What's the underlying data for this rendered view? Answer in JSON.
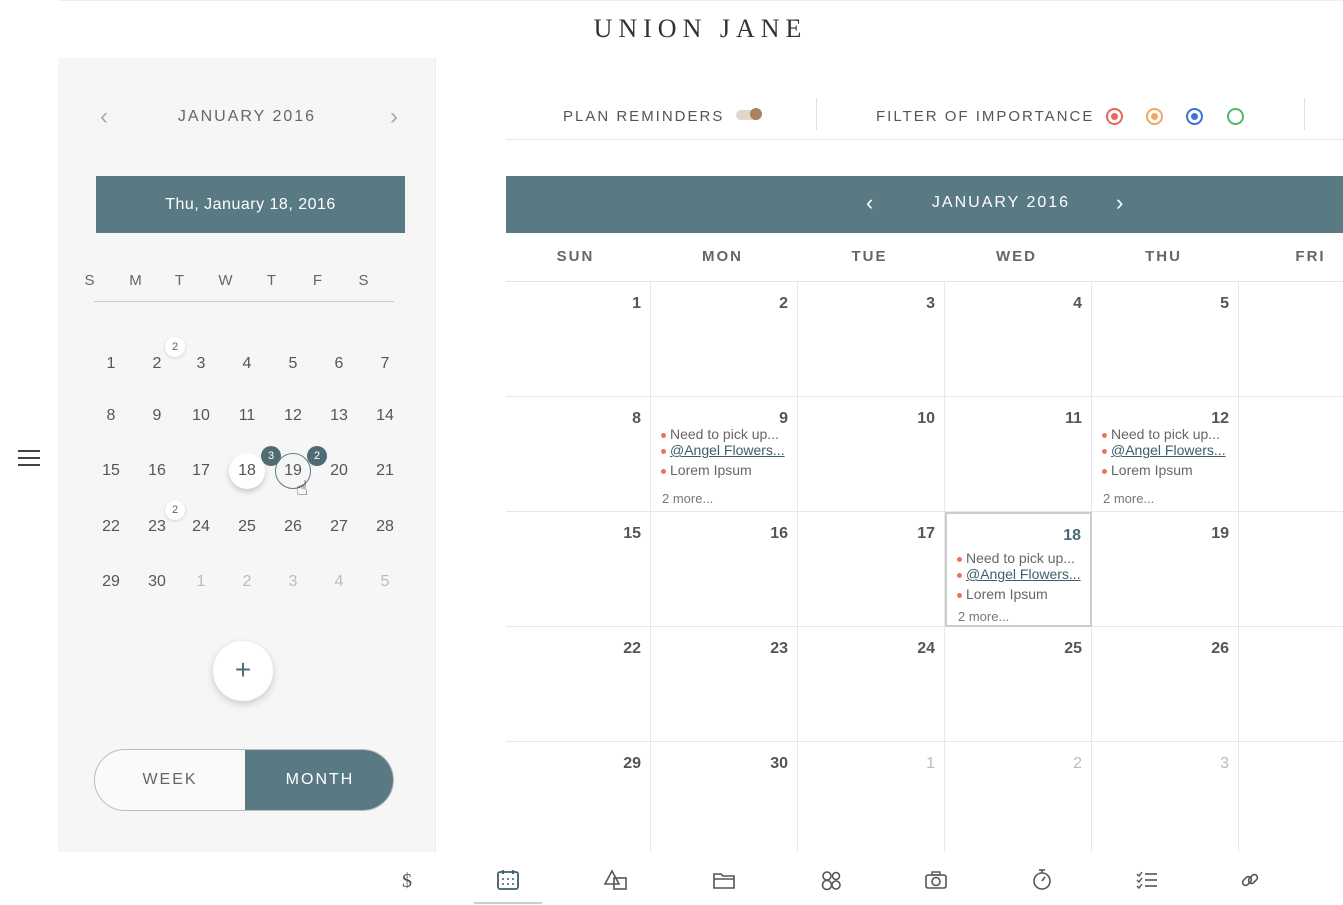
{
  "brand": "UNION JANE",
  "left": {
    "month_label": "JANUARY 2016",
    "selected_date_label": "Thu, January 18, 2016",
    "weekday_headers": [
      "S",
      "M",
      "T",
      "W",
      "T",
      "F",
      "S"
    ],
    "days": [
      {
        "label": "1"
      },
      {
        "label": "2",
        "badge": "2"
      },
      {
        "label": "3"
      },
      {
        "label": "4"
      },
      {
        "label": "5"
      },
      {
        "label": "6"
      },
      {
        "label": "7"
      },
      {
        "label": "8"
      },
      {
        "label": "9"
      },
      {
        "label": "10"
      },
      {
        "label": "11"
      },
      {
        "label": "12"
      },
      {
        "label": "13"
      },
      {
        "label": "14"
      },
      {
        "label": "15"
      },
      {
        "label": "16"
      },
      {
        "label": "17"
      },
      {
        "label": "18",
        "badge": "3",
        "state": "today"
      },
      {
        "label": "19",
        "badge": "2",
        "state": "hover"
      },
      {
        "label": "20"
      },
      {
        "label": "21"
      },
      {
        "label": "22"
      },
      {
        "label": "23",
        "badge": "2"
      },
      {
        "label": "24"
      },
      {
        "label": "25"
      },
      {
        "label": "26"
      },
      {
        "label": "27"
      },
      {
        "label": "28"
      },
      {
        "label": "29"
      },
      {
        "label": "30"
      },
      {
        "label": "1",
        "dim": true
      },
      {
        "label": "2",
        "dim": true
      },
      {
        "label": "3",
        "dim": true
      },
      {
        "label": "4",
        "dim": true
      },
      {
        "label": "5",
        "dim": true
      }
    ],
    "add_label": "+",
    "view_toggle": {
      "week": "WEEK",
      "month": "MONTH",
      "active": "month"
    }
  },
  "filters": {
    "plan_reminders_label": "PLAN REMINDERS",
    "plan_reminders_on": true,
    "importance_label": "FILTER OF IMPORTANCE",
    "importance_colors": [
      "#e8665a",
      "#f0a860",
      "#3f6fd8",
      "#4fb86a"
    ]
  },
  "calendar": {
    "title": "JANUARY 2016",
    "weekdays": [
      "SUN",
      "MON",
      "TUE",
      "WED",
      "THU",
      "FRI"
    ],
    "weeks": [
      [
        {
          "day": "1"
        },
        {
          "day": "2"
        },
        {
          "day": "3"
        },
        {
          "day": "4"
        },
        {
          "day": "5"
        },
        {
          "day": ""
        }
      ],
      [
        {
          "day": "8"
        },
        {
          "day": "9",
          "events": true
        },
        {
          "day": "10"
        },
        {
          "day": "11"
        },
        {
          "day": "12",
          "events": true
        },
        {
          "day": ""
        }
      ],
      [
        {
          "day": "15"
        },
        {
          "day": "16"
        },
        {
          "day": "17"
        },
        {
          "day": "18",
          "events": true,
          "selected": true
        },
        {
          "day": "19"
        },
        {
          "day": ""
        }
      ],
      [
        {
          "day": "22"
        },
        {
          "day": "23"
        },
        {
          "day": "24"
        },
        {
          "day": "25"
        },
        {
          "day": "26"
        },
        {
          "day": ""
        }
      ],
      [
        {
          "day": "29"
        },
        {
          "day": "30"
        },
        {
          "day": "1",
          "dim": true
        },
        {
          "day": "2",
          "dim": true
        },
        {
          "day": "3",
          "dim": true
        },
        {
          "day": ""
        }
      ]
    ],
    "event_lines": [
      "Need to pick up...",
      "@Angel Flowers...",
      "Lorem Ipsum"
    ],
    "more_label": "2 more..."
  },
  "toolbar": {
    "icons": [
      "dollar-icon",
      "calendar-icon",
      "shapes-icon",
      "folder-icon",
      "contacts-icon",
      "camera-icon",
      "stopwatch-icon",
      "checklist-icon",
      "link-icon"
    ],
    "active": "calendar-icon"
  }
}
